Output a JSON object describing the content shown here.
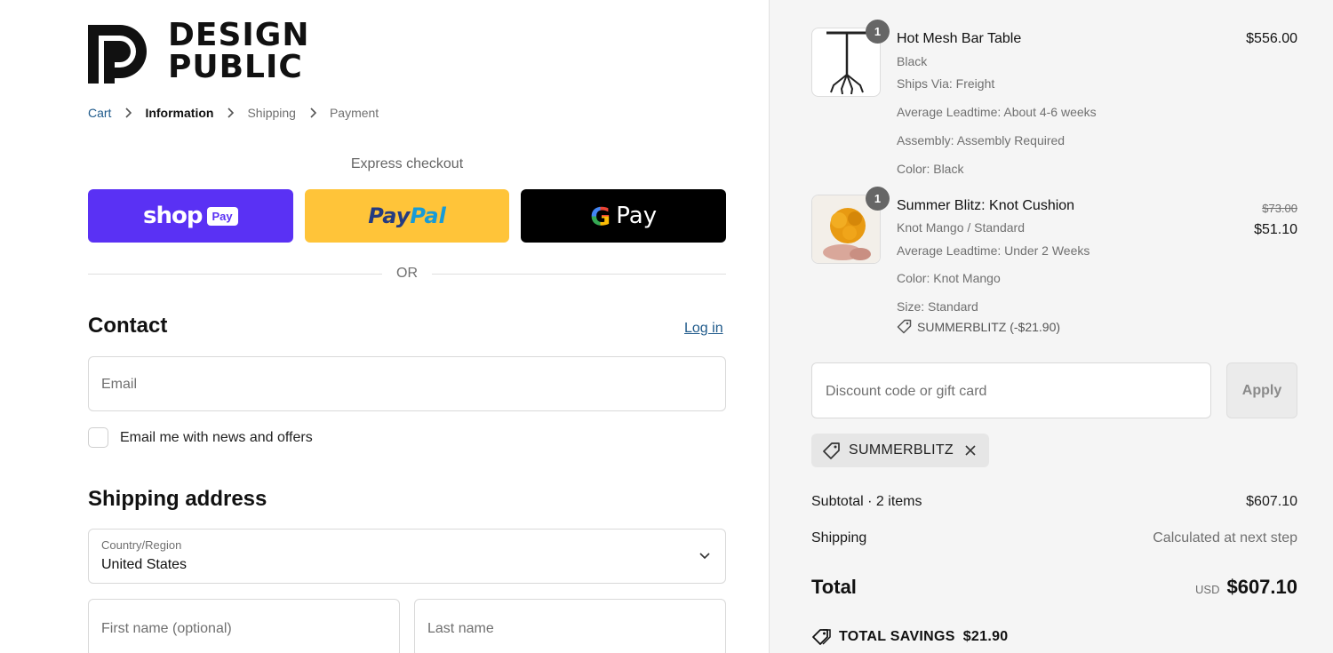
{
  "brand": {
    "line1": "DESIGN",
    "line2": "PUBLIC"
  },
  "breadcrumb": [
    {
      "label": "Cart"
    },
    {
      "label": "Information"
    },
    {
      "label": "Shipping"
    },
    {
      "label": "Payment"
    }
  ],
  "express": {
    "title": "Express checkout",
    "shoppay": {
      "word": "shop",
      "badge": "Pay"
    },
    "paypal": {
      "part1": "Pay",
      "part2": "Pal"
    },
    "gpay": {
      "g": "G",
      "word": "Pay"
    },
    "or": "OR"
  },
  "contact": {
    "title": "Contact",
    "login": "Log in",
    "email_placeholder": "Email",
    "news_label": "Email me with news and offers"
  },
  "shipping": {
    "title": "Shipping address",
    "country_label": "Country/Region",
    "country_value": "United States",
    "first_name_placeholder": "First name (optional)",
    "last_name_placeholder": "Last name"
  },
  "summary": {
    "items": [
      {
        "qty": "1",
        "name": "Hot Mesh Bar Table",
        "details": [
          "Black",
          "Ships Via: Freight",
          "Average Leadtime: About 4-6 weeks",
          "Assembly: Assembly Required",
          "Color: Black"
        ],
        "price": "$556.00"
      },
      {
        "qty": "1",
        "name": "Summer Blitz: Knot Cushion",
        "details": [
          "Knot Mango / Standard",
          "Average Leadtime: Under 2 Weeks",
          "Color: Knot Mango",
          "Size: Standard"
        ],
        "discount": "SUMMERBLITZ (-$21.90)",
        "original_price": "$73.00",
        "price": "$51.10"
      }
    ],
    "discount_placeholder": "Discount code or gift card",
    "apply_label": "Apply",
    "applied_code": "SUMMERBLITZ",
    "subtotal_label": "Subtotal · 2 items",
    "subtotal_value": "$607.10",
    "shipping_label": "Shipping",
    "shipping_value": "Calculated at next step",
    "total_label": "Total",
    "total_currency": "USD",
    "total_value": "$607.10",
    "savings_label": "TOTAL SAVINGS",
    "savings_value": "$21.90"
  },
  "colors": {
    "shoppay": "#5a31f4",
    "paypal": "#ffc439",
    "gpay": "#000000",
    "link": "#1f5a8b",
    "sidebar_bg": "#f5f5f5"
  }
}
